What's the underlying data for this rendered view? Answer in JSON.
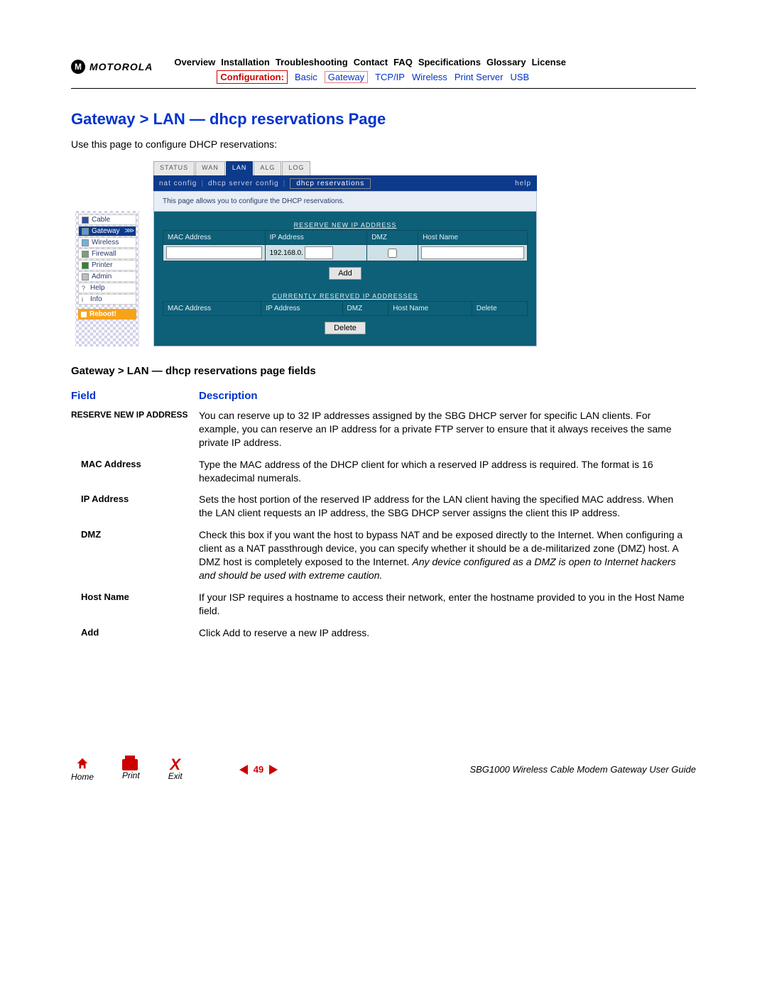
{
  "brand": "MOTOROLA",
  "nav_top": [
    "Overview",
    "Installation",
    "Troubleshooting",
    "Contact",
    "FAQ",
    "Specifications",
    "Glossary",
    "License"
  ],
  "nav_sub": {
    "boxed": "Configuration:",
    "items": [
      "Basic",
      "Gateway",
      "TCP/IP",
      "Wireless",
      "Print Server",
      "USB"
    ],
    "dotted_index": 1
  },
  "title": "Gateway > LAN — dhcp reservations Page",
  "intro": "Use this page to configure DHCP reservations:",
  "sidenav": {
    "items": [
      {
        "label": "Cable",
        "color": "#2a4fa0"
      },
      {
        "label": "Gateway",
        "color": "#4aa0d8",
        "active": true,
        "arrow": ">>>"
      },
      {
        "label": "Wireless",
        "color": "#6fb3e0"
      },
      {
        "label": "Firewall",
        "color": "#7aa07a"
      },
      {
        "label": "Printer",
        "color": "#2a8a2a"
      },
      {
        "label": "Admin",
        "color": "#bdbdbd"
      },
      {
        "label": "Help",
        "mark": "?"
      },
      {
        "label": "Info",
        "mark": "i"
      }
    ],
    "reboot": "Reboot!"
  },
  "tabs": [
    "STATUS",
    "WAN",
    "LAN",
    "ALG",
    "LOG"
  ],
  "tabs_active": 2,
  "subbar": {
    "items": [
      "nat config",
      "dhcp server config",
      "dhcp reservations"
    ],
    "current": 2,
    "help": "help"
  },
  "panel_desc": "This page allows you to configure the DHCP reservations.",
  "group1": {
    "title": "RESERVE NEW IP ADDRESS",
    "headers": [
      "MAC Address",
      "IP Address",
      "DMZ",
      "Host Name"
    ],
    "ip_prefix": "192.168.0.",
    "add_btn": "Add"
  },
  "group2": {
    "title": "CURRENTLY RESERVED IP ADDRESSES",
    "headers": [
      "MAC Address",
      "IP Address",
      "DMZ",
      "Host Name",
      "Delete"
    ],
    "delete_btn": "Delete"
  },
  "fields_title": "Gateway > LAN — dhcp reservations page fields",
  "field_th": {
    "f": "Field",
    "d": "Description"
  },
  "fields": [
    {
      "name": "RESERVE NEW IP ADDRESS",
      "upper": true,
      "desc": "You can reserve up to 32 IP addresses assigned by the SBG DHCP server for specific LAN clients. For example, you can reserve an IP address for a private FTP server to ensure that it always receives the same private IP address."
    },
    {
      "name": "MAC Address",
      "sub": true,
      "desc": "Type the MAC address of the DHCP client for which a reserved IP address is required. The format is 16 hexadecimal numerals."
    },
    {
      "name": "IP Address",
      "sub": true,
      "desc": "Sets the host portion of the reserved IP address for the LAN client having the specified MAC address. When the LAN client requests an IP address, the SBG DHCP server assigns the client this IP address."
    },
    {
      "name": "DMZ",
      "sub": true,
      "desc_html": "Check this box if you want the host to bypass NAT and be exposed directly to the Internet. When configuring a client as a NAT passthrough device, you can specify whether it should be a de-militarized zone (DMZ) host. A DMZ host is completely exposed to the Internet. <em>Any device configured as a DMZ is open to Internet hackers and should be used with extreme caution.</em>"
    },
    {
      "name": "Host Name",
      "sub": true,
      "desc": "If your ISP requires a hostname to access their network, enter the hostname provided to you in the Host Name field."
    },
    {
      "name": "Add",
      "sub": true,
      "desc": "Click Add to reserve a new IP address."
    }
  ],
  "footer": {
    "home": "Home",
    "print": "Print",
    "exit": "Exit",
    "page": "49",
    "guide": "SBG1000 Wireless Cable Modem Gateway User Guide"
  }
}
